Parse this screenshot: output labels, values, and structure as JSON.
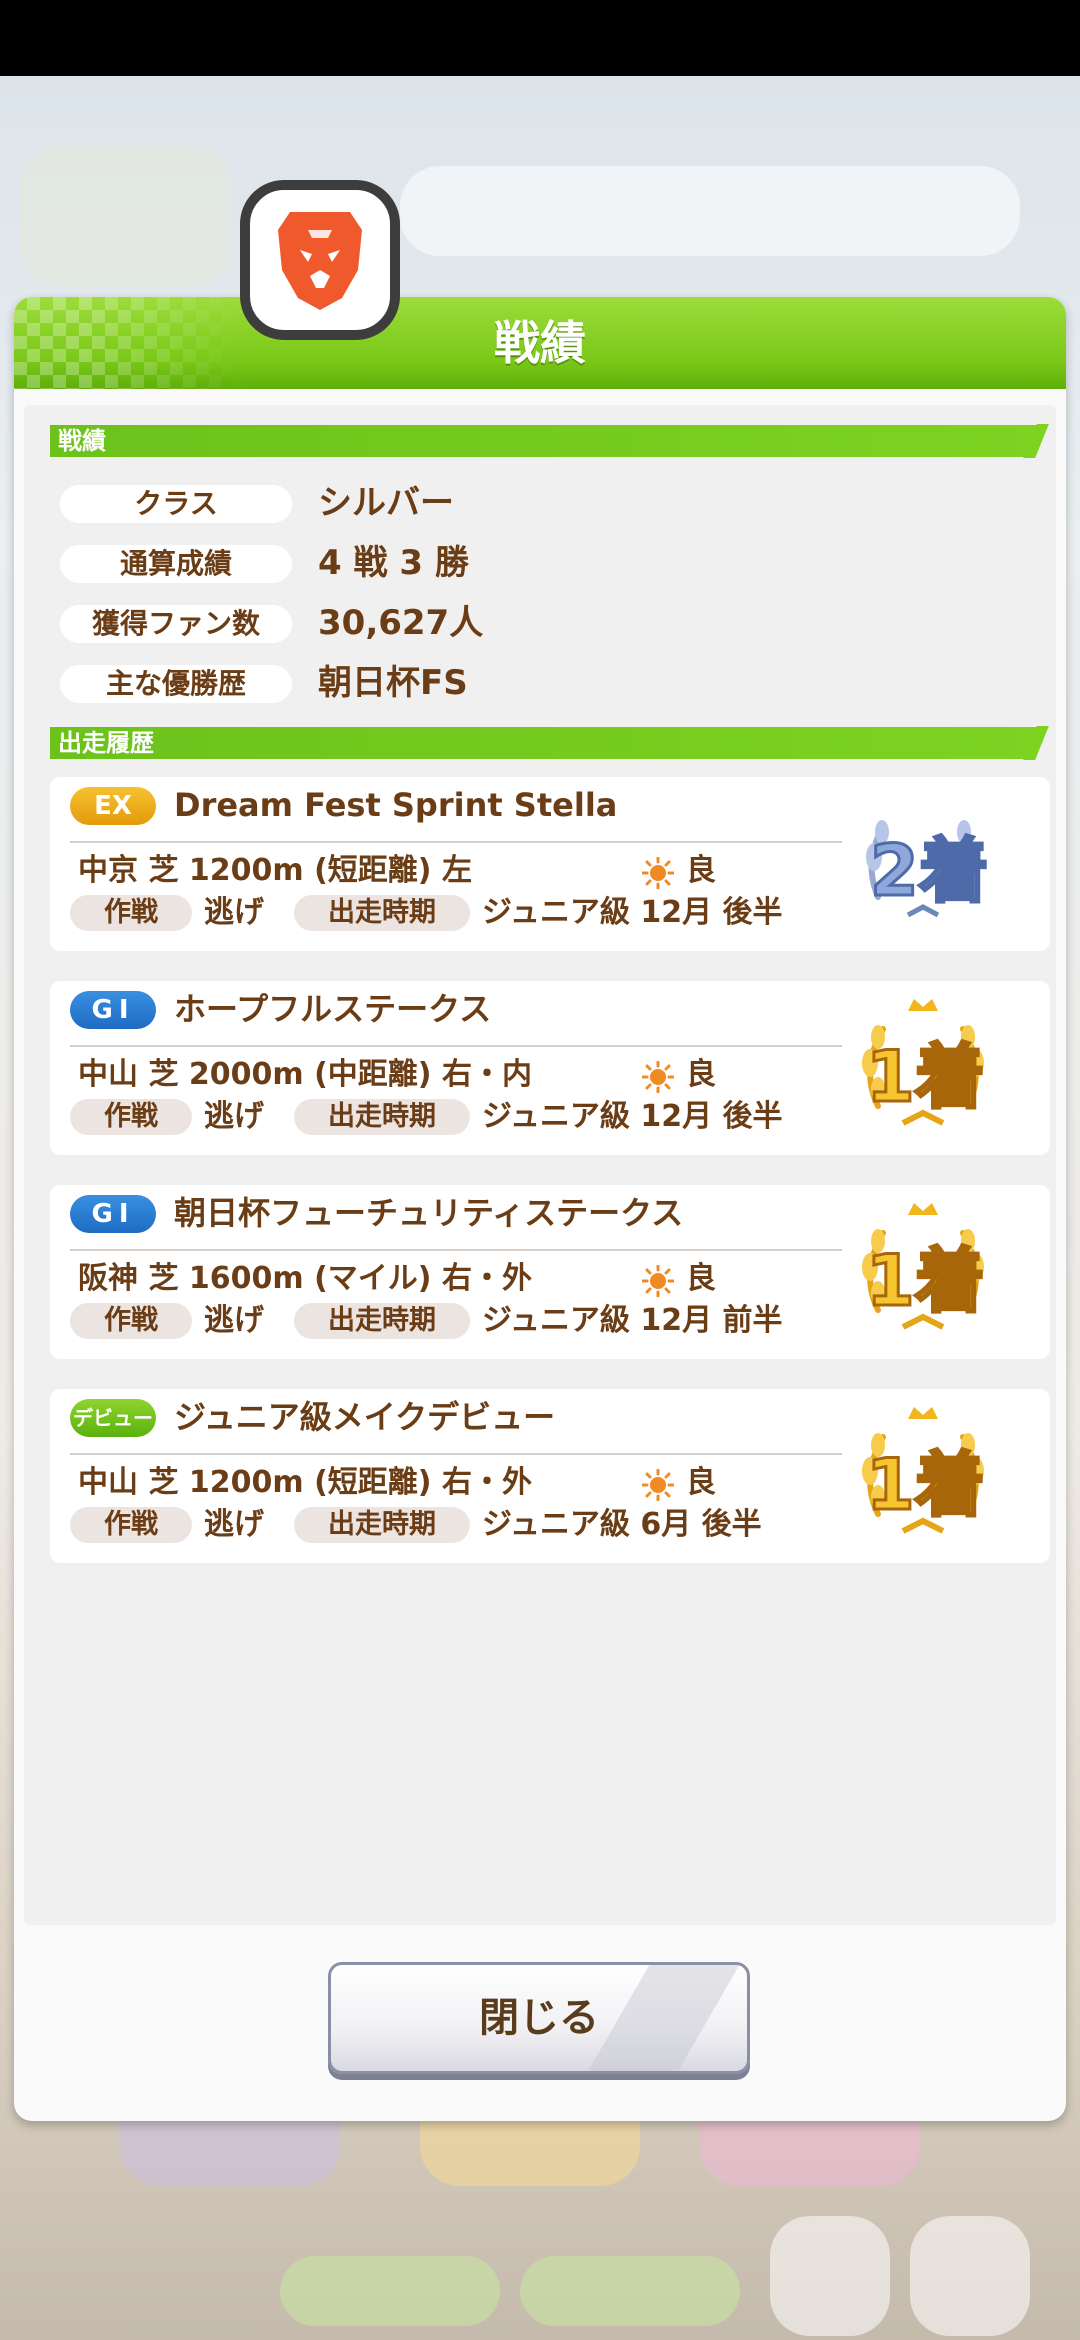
{
  "dialog": {
    "title": "戦績",
    "section_record": "戦績",
    "section_history": "出走履歴",
    "close_label": "閉じる"
  },
  "stats": [
    {
      "label": "クラス",
      "value": "シルバー"
    },
    {
      "label": "通算成績",
      "value": "4 戦 3 勝"
    },
    {
      "label": "獲得ファン数",
      "value": "30,627人"
    },
    {
      "label": "主な優勝歴",
      "value": "朝日杯FS"
    }
  ],
  "races": [
    {
      "grade": "EX",
      "grade_type": "ex",
      "name": "Dream Fest Sprint Stella",
      "venue": "中京 芝 1200m (短距離) 左",
      "weather": "良",
      "tag1": "作戦",
      "strategy": "逃げ",
      "tag2": "出走時期",
      "period": "ジュニア級 12月 後半",
      "rank": "2着"
    },
    {
      "grade": "GⅠ",
      "grade_type": "g1",
      "name": "ホープフルステークス",
      "venue": "中山 芝 2000m (中距離) 右・内",
      "weather": "良",
      "tag1": "作戦",
      "strategy": "逃げ",
      "tag2": "出走時期",
      "period": "ジュニア級 12月 後半",
      "rank": "1着"
    },
    {
      "grade": "GⅠ",
      "grade_type": "g1",
      "name": "朝日杯フューチュリティステークス",
      "venue": "阪神 芝 1600m (マイル) 右・外",
      "weather": "良",
      "tag1": "作戦",
      "strategy": "逃げ",
      "tag2": "出走時期",
      "period": "ジュニア級 12月 前半",
      "rank": "1着"
    },
    {
      "grade": "デビュー",
      "grade_type": "debut",
      "name": "ジュニア級メイクデビュー",
      "venue": "中山 芝 1200m (短距離) 右・外",
      "weather": "良",
      "tag1": "作戦",
      "strategy": "逃げ",
      "tag2": "出走時期",
      "period": "ジュニア級 6月 後半",
      "rank": "1着"
    }
  ],
  "colors": {
    "accent": "#7ed321",
    "text": "#6b3d16",
    "gold": "#f2b51d",
    "silver": "#8ea6d6"
  }
}
